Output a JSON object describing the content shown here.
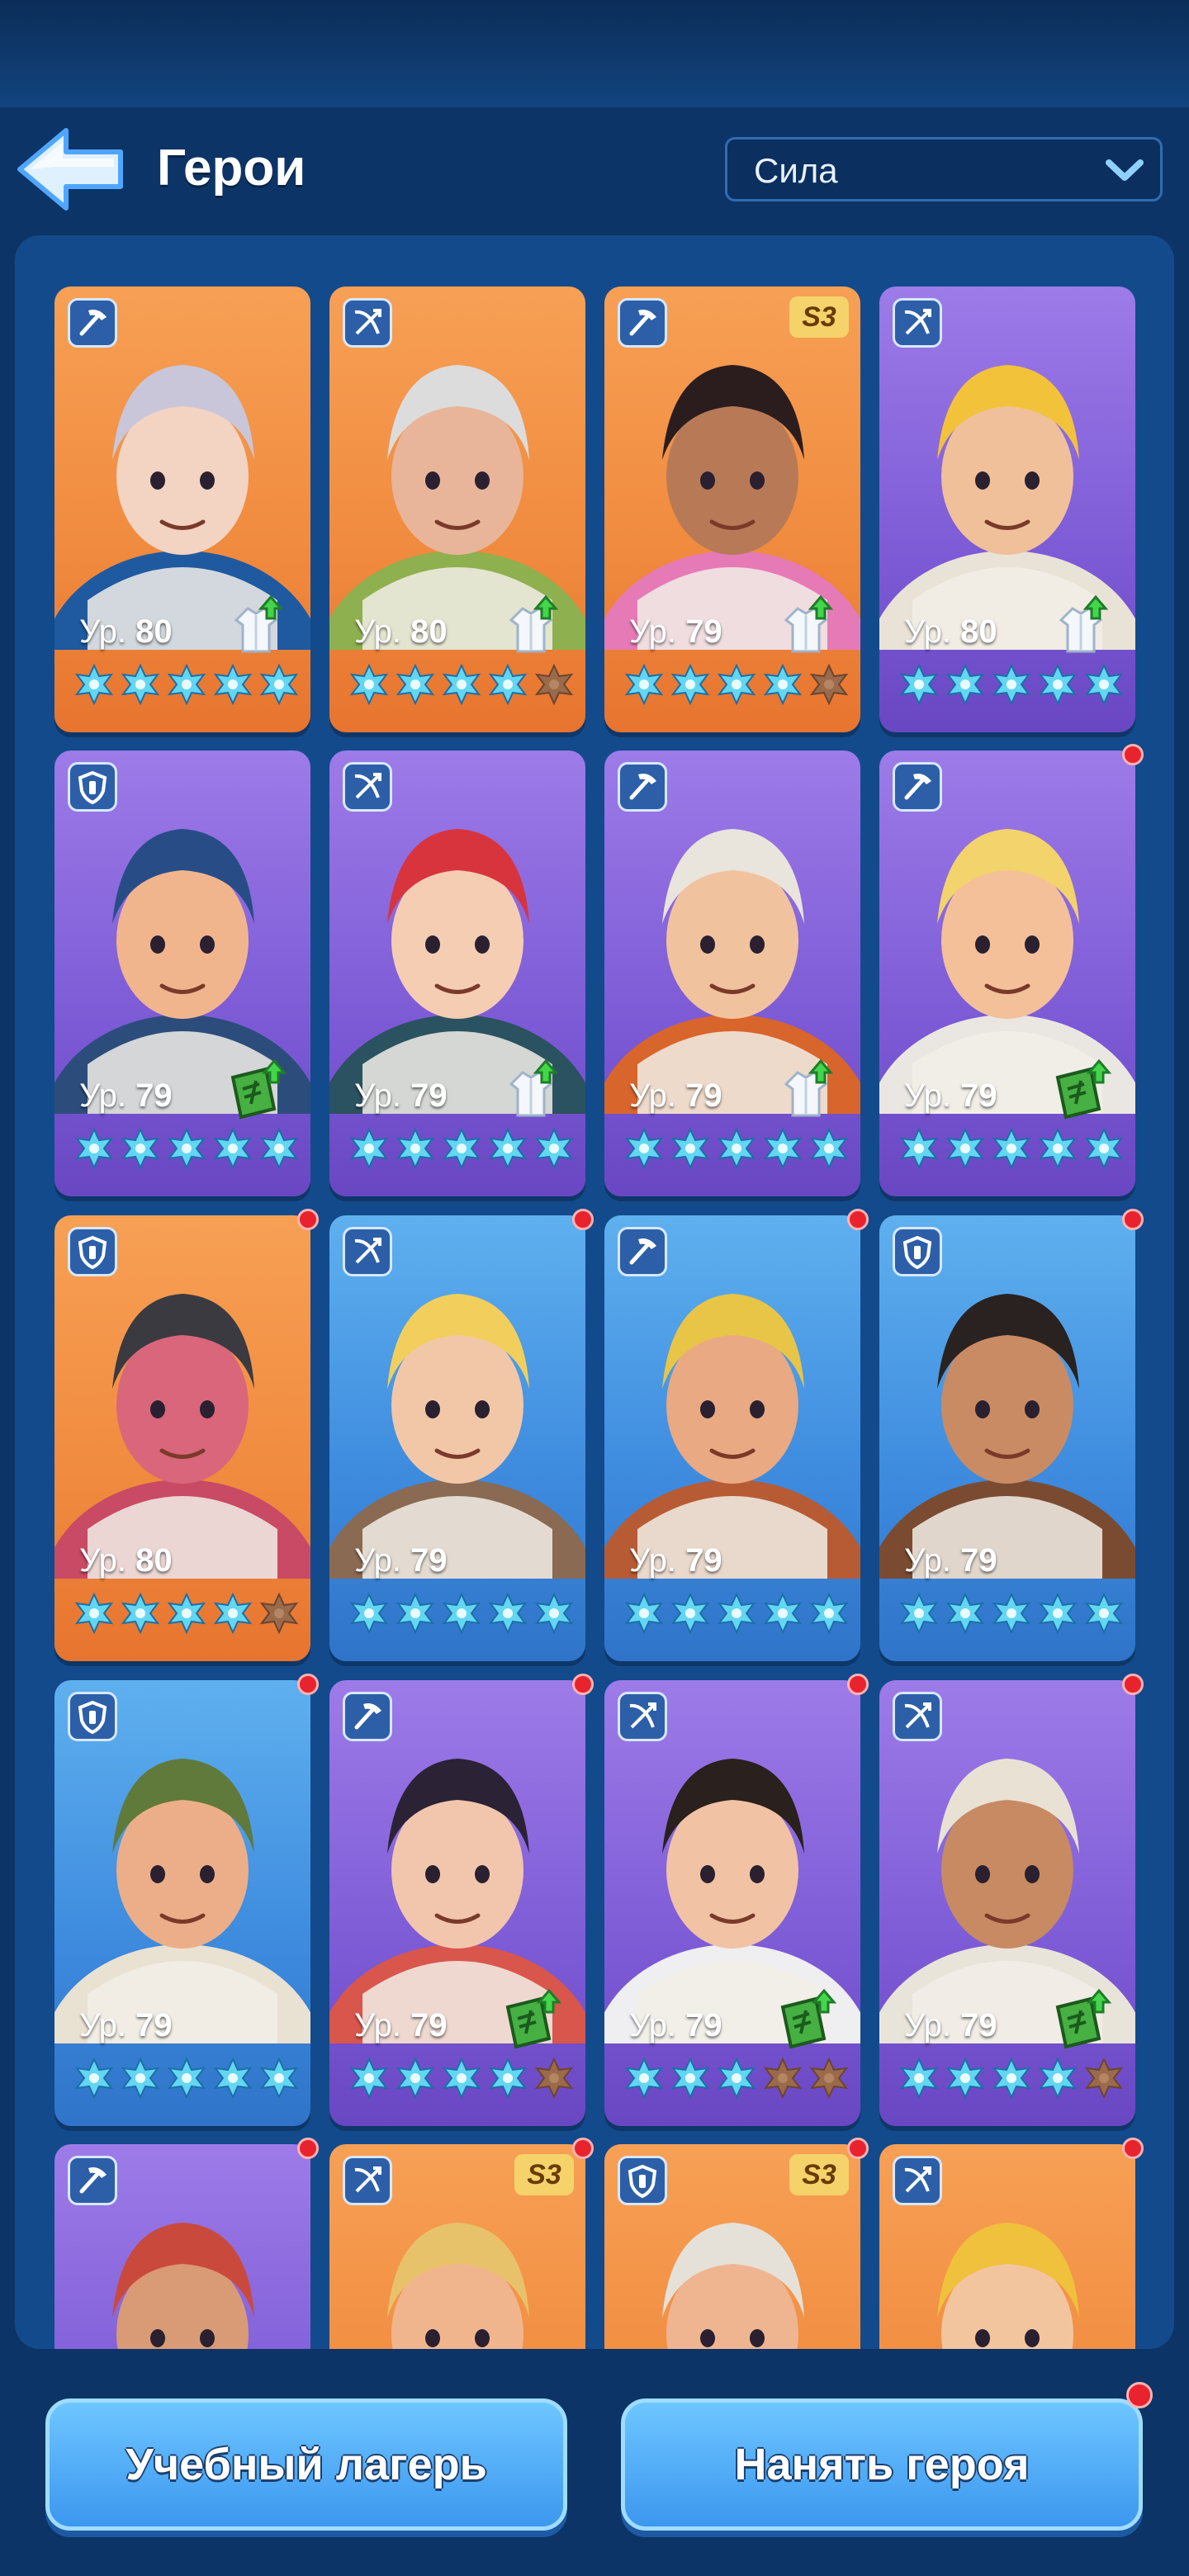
{
  "header": {
    "title": "Герои",
    "sort": {
      "selected": "Сила"
    }
  },
  "level_prefix": "Ур.",
  "cards": [
    {
      "class": "pickaxe-icon",
      "bg": "orange",
      "level": "80",
      "upgrade": "shirt-icon",
      "stars": 5,
      "badge": "",
      "dot": false,
      "skin": "#f3d3c1",
      "hair": "#c9c6d9",
      "outfit": "#1f5aa0"
    },
    {
      "class": "crossbow-icon",
      "bg": "orange",
      "level": "80",
      "upgrade": "shirt-icon",
      "stars": 4,
      "badge": "",
      "dot": false,
      "skin": "#e8b59a",
      "hair": "#dcdcdc",
      "outfit": "#8fb04e"
    },
    {
      "class": "pickaxe-icon",
      "bg": "orange",
      "level": "79",
      "upgrade": "shirt-icon",
      "stars": 4,
      "badge": "S3",
      "dot": false,
      "skin": "#b87a56",
      "hair": "#2b1d1d",
      "outfit": "#e57ab6"
    },
    {
      "class": "crossbow-icon",
      "bg": "purple",
      "level": "80",
      "upgrade": "shirt-icon",
      "stars": 5,
      "badge": "",
      "dot": false,
      "skin": "#f0c09a",
      "hair": "#f2c23a",
      "outfit": "#e9e2d6"
    },
    {
      "class": "shield-icon",
      "bg": "purple",
      "level": "79",
      "upgrade": "manual-icon",
      "stars": 5,
      "badge": "",
      "dot": false,
      "skin": "#f1b58e",
      "hair": "#284d86",
      "outfit": "#2c4d7c"
    },
    {
      "class": "crossbow-icon",
      "bg": "purple",
      "level": "79",
      "upgrade": "shirt-icon",
      "stars": 5,
      "badge": "",
      "dot": false,
      "skin": "#f4cdb3",
      "hair": "#d8343e",
      "outfit": "#2b5260"
    },
    {
      "class": "pickaxe-icon",
      "bg": "purple",
      "level": "79",
      "upgrade": "shirt-icon",
      "stars": 5,
      "badge": "",
      "dot": false,
      "skin": "#f1c29e",
      "hair": "#e9e4dc",
      "outfit": "#d8652b"
    },
    {
      "class": "pickaxe-icon",
      "bg": "purple",
      "level": "79",
      "upgrade": "manual-icon",
      "stars": 5,
      "badge": "",
      "dot": true,
      "skin": "#f3c09a",
      "hair": "#f3d36b",
      "outfit": "#eae7e2"
    },
    {
      "class": "shield-icon",
      "bg": "orange",
      "level": "80",
      "upgrade": "",
      "stars": 4,
      "badge": "",
      "dot": true,
      "skin": "#d9667a",
      "hair": "#3a3a40",
      "outfit": "#c84a64"
    },
    {
      "class": "crossbow-icon",
      "bg": "blue",
      "level": "79",
      "upgrade": "",
      "stars": 5,
      "badge": "",
      "dot": true,
      "skin": "#f2c7a8",
      "hair": "#f2cf5c",
      "outfit": "#8a6a52"
    },
    {
      "class": "pickaxe-icon",
      "bg": "blue",
      "level": "79",
      "upgrade": "",
      "stars": 5,
      "badge": "",
      "dot": true,
      "skin": "#e9a982",
      "hair": "#e8c547",
      "outfit": "#b75b34"
    },
    {
      "class": "shield-icon",
      "bg": "blue",
      "level": "79",
      "upgrade": "",
      "stars": 5,
      "badge": "",
      "dot": true,
      "skin": "#c98b64",
      "hair": "#2a2220",
      "outfit": "#7a4b31"
    },
    {
      "class": "shield-icon",
      "bg": "blue",
      "level": "79",
      "upgrade": "",
      "stars": 5,
      "badge": "",
      "dot": true,
      "skin": "#ecae88",
      "hair": "#5f7a3a",
      "outfit": "#e9e1d2"
    },
    {
      "class": "pickaxe-icon",
      "bg": "purple",
      "level": "79",
      "upgrade": "manual-icon",
      "stars": 4,
      "badge": "",
      "dot": true,
      "skin": "#f2c6ad",
      "hair": "#2b2236",
      "outfit": "#d9564c"
    },
    {
      "class": "crossbow-icon",
      "bg": "purple",
      "level": "79",
      "upgrade": "manual-icon",
      "stars": 3,
      "badge": "",
      "dot": true,
      "skin": "#f1c2a4",
      "hair": "#2a201d",
      "outfit": "#efeef0"
    },
    {
      "class": "crossbow-icon",
      "bg": "purple",
      "level": "79",
      "upgrade": "manual-icon",
      "stars": 4,
      "badge": "",
      "dot": true,
      "skin": "#c88a62",
      "hair": "#e9e2d4",
      "outfit": "#e8e4da"
    },
    {
      "class": "pickaxe-icon",
      "bg": "purple",
      "level": "",
      "upgrade": "",
      "stars": 0,
      "badge": "",
      "dot": true,
      "skin": "#d99a76",
      "hair": "#c94a3c",
      "outfit": "#7a5fcc"
    },
    {
      "class": "crossbow-icon",
      "bg": "orange",
      "level": "",
      "upgrade": "",
      "stars": 0,
      "badge": "S3",
      "dot": true,
      "skin": "#f1b58e",
      "hair": "#e8c26a",
      "outfit": "#f08a3e"
    },
    {
      "class": "shield-icon",
      "bg": "orange",
      "level": "",
      "upgrade": "",
      "stars": 0,
      "badge": "S3",
      "dot": true,
      "skin": "#efb591",
      "hair": "#e6e1d8",
      "outfit": "#f08a3e"
    },
    {
      "class": "crossbow-icon",
      "bg": "orange",
      "level": "",
      "upgrade": "",
      "stars": 0,
      "badge": "",
      "dot": true,
      "skin": "#f3c59f",
      "hair": "#f0c13c",
      "outfit": "#f08a3e"
    }
  ],
  "buttons": {
    "training": "Учебный лагерь",
    "hire": "Нанять героя",
    "hire_dot": true
  },
  "colors": {
    "star_on": "#63d6f2",
    "star_off": "#9a6a4a",
    "badge_s3": "#f5d36a",
    "dot": "#e8232e"
  }
}
